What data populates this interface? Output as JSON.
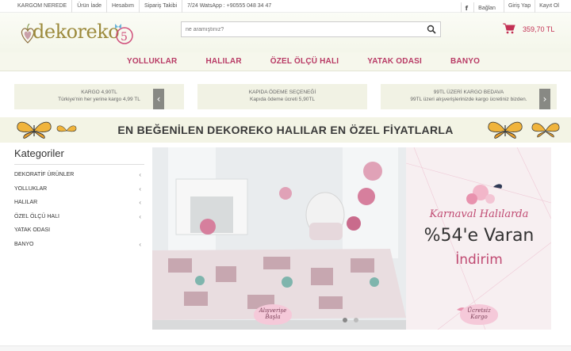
{
  "topbar": {
    "links": [
      "KARGOM NEREDE",
      "Ürün İade",
      "Hesabım",
      "Sipariş Takibi",
      "7/24 WatsApp : +90555 048 34 47"
    ],
    "facebook_label": "Bağlan",
    "login_label": "Giriş Yap",
    "register_label": "Kayıt Ol"
  },
  "header": {
    "logo_text": "dekoreko",
    "search_placeholder": "ne aramıştınız?",
    "cart_total": "359,70 TL"
  },
  "nav": {
    "items": [
      "YOLLUKLAR",
      "HALILAR",
      "ÖZEL ÖLÇÜ HALI",
      "YATAK ODASI",
      "BANYO"
    ]
  },
  "info": [
    {
      "title": "KARGO 4,90TL",
      "desc": "Türkiye'nin her yerine kargo 4,99 TL"
    },
    {
      "title": "KAPIDA ÖDEME SEÇENEĞİ",
      "desc": "Kapıda ödeme ücreti 5,90TL"
    },
    {
      "title": "99TL ÜZERİ KARGO BEDAVA",
      "desc": "99TL üzeri alışverişlerinizde kargo ücretiniz bizden."
    }
  ],
  "strip": {
    "text": "EN BEĞENİLEN DEKOREKO HALILAR EN ÖZEL FİYATLARLA"
  },
  "sidebar": {
    "title": "Kategoriler",
    "items": [
      {
        "label": "DEKORATİF ÜRÜNLER",
        "has_children": true
      },
      {
        "label": "YOLLUKLAR",
        "has_children": true
      },
      {
        "label": "HALILAR",
        "has_children": true
      },
      {
        "label": "ÖZEL ÖLÇÜ HALI",
        "has_children": true
      },
      {
        "label": "YATAK ODASI",
        "has_children": false
      },
      {
        "label": "BANYO",
        "has_children": true
      }
    ]
  },
  "slider": {
    "promo_line1": "Karnaval Halılarda",
    "promo_line2": "%54'e Varan",
    "promo_line3": "İndirim",
    "badge_left": "Alışverişe Başla",
    "badge_right": "Ücretsiz Kargo",
    "slide_count": 2,
    "active_slide": 1
  },
  "colors": {
    "accent": "#b83a65",
    "cart": "#c33155",
    "header_bg": "#f6f7ec"
  }
}
